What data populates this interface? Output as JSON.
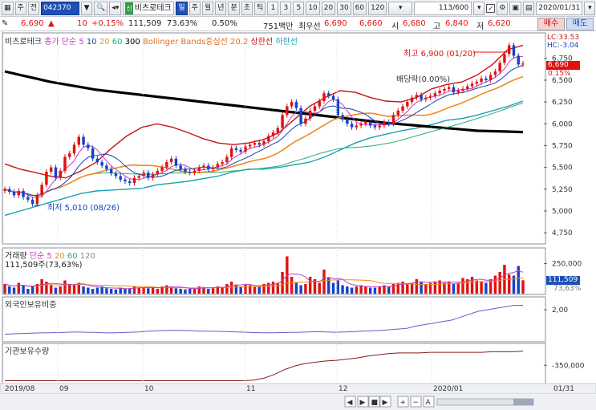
{
  "toolbar": {
    "code": "042370",
    "name": "비츠로테크",
    "sin_badge": "신",
    "periods": [
      "일",
      "주",
      "월",
      "년",
      "분",
      "초",
      "틱"
    ],
    "active_period": "일",
    "minute_nums": [
      "1",
      "3",
      "5",
      "10",
      "20",
      "30",
      "60",
      "120"
    ],
    "counter": "113/600",
    "date": "2020/01/31",
    "misc": [
      "주",
      "전",
      "Q"
    ]
  },
  "quote": {
    "price": "6,690",
    "change": "10",
    "change_pct": "+0.15%",
    "volume": "111,509",
    "vol_ratio": "73.63%",
    "turnover_pct": "0.50%",
    "trade_value": "751백만",
    "best_ask_label": "최우선",
    "best_ask": "6,690",
    "best_bid": "6,660",
    "open_label": "시",
    "open": "6,680",
    "high_label": "고",
    "high": "6,840",
    "low_label": "저",
    "low": "6,620",
    "buy_label": "매수",
    "sell_label": "매도"
  },
  "colors": {
    "up": "#e0120f",
    "down": "#1442c8",
    "ma5": "#c040c0",
    "ma10": "#1a3fb0",
    "ma20": "#f08a20",
    "ma60": "#20b070",
    "ma300": "#000000",
    "boll_mid": "#e07020",
    "boll_up": "#c81414",
    "boll_dn": "#18a0b0"
  },
  "chart_data": [
    {
      "type": "line",
      "panel": "price",
      "legend": [
        {
          "text": "비츠로테크",
          "color": "#333333"
        },
        {
          "text": "종가 단순 5",
          "color": "#c040c0"
        },
        {
          "text": "10",
          "color": "#1a3fb0"
        },
        {
          "text": "20",
          "color": "#f08a20"
        },
        {
          "text": "60",
          "color": "#20b070"
        },
        {
          "text": "300",
          "color": "#000000"
        },
        {
          "text": "Bollinger Bands중심선 20.2",
          "color": "#e07020"
        },
        {
          "text": "상한선",
          "color": "#c81414"
        },
        {
          "text": "하한선",
          "color": "#18a0b0"
        }
      ],
      "y_ticks": [
        "6,750",
        "6,500",
        "6,250",
        "6,000",
        "5,750",
        "5,500",
        "5,250",
        "5,000",
        "4,750"
      ],
      "y_tick_values": [
        6750,
        6500,
        6250,
        6000,
        5750,
        5500,
        5250,
        5000,
        4750
      ],
      "ylim": [
        4650,
        6950
      ],
      "right_labels": {
        "lc": "LC:33.53",
        "hc": "HC:-3.04",
        "current": "6,690",
        "pct": "0.15%"
      },
      "annotations": {
        "high": "최고 6,900 (01/20)",
        "low": "최저 5,010 (08/26)",
        "dividend": "배당락(0.00%)"
      },
      "closes": [
        5250,
        5220,
        5180,
        5230,
        5160,
        5130,
        5080,
        5180,
        5300,
        5450,
        5500,
        5380,
        5460,
        5620,
        5660,
        5760,
        5850,
        5760,
        5720,
        5600,
        5560,
        5520,
        5480,
        5430,
        5400,
        5360,
        5340,
        5320,
        5380,
        5400,
        5440,
        5380,
        5420,
        5460,
        5500,
        5560,
        5600,
        5520,
        5480,
        5450,
        5440,
        5460,
        5500,
        5520,
        5480,
        5500,
        5540,
        5560,
        5620,
        5720,
        5700,
        5680,
        5740,
        5760,
        5780,
        5760,
        5800,
        5860,
        5900,
        5950,
        6100,
        6200,
        6250,
        6180,
        6000,
        6060,
        6150,
        6200,
        6260,
        6350,
        6320,
        6280,
        6100,
        6050,
        6000,
        5960,
        5980,
        6000,
        6020,
        5980,
        5960,
        5980,
        6020,
        6000,
        6100,
        6150,
        6200,
        6250,
        6300,
        6330,
        6280,
        6300,
        6320,
        6350,
        6380,
        6400,
        6420,
        6360,
        6380,
        6400,
        6430,
        6460,
        6480,
        6520,
        6500,
        6560,
        6600,
        6700,
        6800,
        6900,
        6780,
        6680,
        6690
      ],
      "ma300": [
        6600,
        6560,
        6520,
        6480,
        6450,
        6420,
        6390,
        6370,
        6350,
        6330,
        6310,
        6290,
        6270,
        6250,
        6230,
        6210,
        6190,
        6170,
        6150,
        6130,
        6110,
        6090,
        6070,
        6050,
        6030,
        6010,
        5995,
        5980,
        5965,
        5950,
        5935,
        5920,
        5915,
        5910,
        5905
      ],
      "bb_upper": [
        5540,
        5480,
        5440,
        5400,
        5380,
        5460,
        5560,
        5720,
        5860,
        5960,
        6000,
        5960,
        5900,
        5830,
        5780,
        5760,
        5780,
        5820,
        5900,
        6050,
        6200,
        6300,
        6380,
        6360,
        6300,
        6260,
        6250,
        6300,
        6400,
        6450,
        6480,
        6560,
        6680,
        6850,
        6900
      ],
      "bb_lower": [
        4950,
        5000,
        5050,
        5100,
        5150,
        5200,
        5230,
        5240,
        5250,
        5260,
        5300,
        5320,
        5340,
        5370,
        5400,
        5450,
        5480,
        5480,
        5500,
        5530,
        5560,
        5620,
        5700,
        5780,
        5840,
        5880,
        5920,
        5950,
        5990,
        6040,
        6060,
        6100,
        6150,
        6200,
        6260
      ]
    },
    {
      "type": "bar",
      "panel": "volume",
      "legend": [
        {
          "text": "거래량",
          "color": "#333333"
        },
        {
          "text": "단순 5",
          "color": "#c040c0"
        },
        {
          "text": "20",
          "color": "#f08a20"
        },
        {
          "text": "60",
          "color": "#20b070"
        },
        {
          "text": "120",
          "color": "#888888"
        }
      ],
      "subtitle": "111,509주(73,63%)",
      "y_ticks": [
        "250,000"
      ],
      "ylim": [
        0,
        300000
      ],
      "current_label": "111,509",
      "current_pct": "73,63%",
      "values": [
        80000,
        60000,
        50000,
        90000,
        70000,
        40000,
        60000,
        80000,
        120000,
        100000,
        70000,
        50000,
        60000,
        110000,
        80000,
        70000,
        90000,
        60000,
        50000,
        40000,
        50000,
        60000,
        45000,
        40000,
        35000,
        50000,
        40000,
        45000,
        60000,
        50000,
        55000,
        45000,
        50000,
        40000,
        60000,
        70000,
        60000,
        45000,
        40000,
        35000,
        40000,
        45000,
        60000,
        55000,
        40000,
        45000,
        60000,
        55000,
        80000,
        100000,
        70000,
        60000,
        80000,
        70000,
        60000,
        60000,
        80000,
        90000,
        100000,
        90000,
        180000,
        310000,
        140000,
        90000,
        70000,
        80000,
        140000,
        120000,
        90000,
        200000,
        130000,
        90000,
        110000,
        70000,
        60000,
        50000,
        60000,
        70000,
        60000,
        50000,
        50000,
        60000,
        70000,
        60000,
        80000,
        90000,
        100000,
        80000,
        90000,
        120000,
        100000,
        80000,
        90000,
        100000,
        110000,
        90000,
        100000,
        80000,
        90000,
        130000,
        120000,
        140000,
        110000,
        100000,
        90000,
        120000,
        150000,
        180000,
        240000,
        160000,
        150000,
        230000,
        111509
      ]
    },
    {
      "type": "line",
      "panel": "foreign",
      "title": "외국인보유비중",
      "y_ticks": [
        "2,00"
      ],
      "values": [
        0.35,
        0.38,
        0.4,
        0.42,
        0.44,
        0.45,
        0.46,
        0.48,
        0.5,
        0.48,
        0.47,
        0.45,
        0.44,
        0.46,
        0.48,
        0.5,
        0.55,
        0.58,
        0.6,
        0.62,
        0.6,
        0.58,
        0.56,
        0.55,
        0.54,
        0.52,
        0.5,
        0.48,
        0.46,
        0.45,
        0.45,
        0.46,
        0.47,
        0.48,
        0.5,
        0.52,
        0.5,
        0.48,
        0.5,
        0.52,
        0.55,
        0.58,
        0.6,
        0.65,
        0.7,
        0.75,
        0.9,
        1.0,
        1.1,
        1.2,
        1.3,
        1.5,
        1.7,
        1.9,
        2.0,
        2.1,
        2.2,
        2.3,
        2.3
      ],
      "ylim": [
        0,
        2.6
      ]
    },
    {
      "type": "line",
      "panel": "institution",
      "title": "기관보유수량",
      "y_ticks": [
        "-350,000"
      ],
      "values": [
        -600000,
        -600000,
        -600000,
        -600000,
        -600000,
        -600000,
        -600000,
        -600000,
        -600000,
        -600000,
        -600000,
        -600000,
        -600000,
        -600000,
        -600000,
        -600000,
        -600000,
        -600000,
        -600000,
        -600000,
        -600000,
        -600000,
        -600000,
        -600000,
        -590000,
        -560000,
        -500000,
        -420000,
        -360000,
        -320000,
        -300000,
        -280000,
        -270000,
        -250000,
        -230000,
        -200000,
        -180000,
        -160000,
        -150000,
        -150000,
        -150000,
        -140000,
        -140000,
        -140000,
        -140000,
        -140000,
        -140000,
        -130000,
        -130000,
        -130000,
        -120000
      ],
      "ylim": [
        -620000,
        -60000
      ]
    }
  ],
  "x_axis": {
    "labels": [
      "2019/08",
      "09",
      "10",
      "11",
      "12",
      "2020/01"
    ],
    "corner_label": "01/31"
  },
  "bottom_controls": [
    "◀",
    "▶",
    "■",
    "▶",
    "+",
    "−",
    "A"
  ]
}
